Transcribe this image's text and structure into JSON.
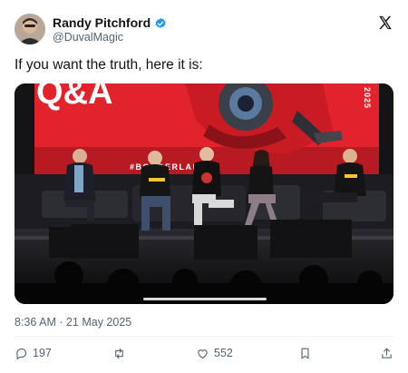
{
  "author": {
    "name": "Randy Pitchford",
    "handle": "@DuvalMagic",
    "verified": true
  },
  "brand_icon": "x-logo-icon",
  "tweet": {
    "text": "If you want the truth, here it is:",
    "timestamp": "8:36 AM · 21 May 2025"
  },
  "media": {
    "type": "video",
    "banner_text": "Q&A",
    "hashtag": "#BORDERLANDS4",
    "year": "2025",
    "accent_color": "#e8232a"
  },
  "actions": {
    "reply": {
      "icon": "reply-icon",
      "count": "197"
    },
    "repost": {
      "icon": "repost-icon"
    },
    "like": {
      "icon": "heart-icon",
      "count": "552"
    },
    "bookmark": {
      "icon": "bookmark-icon"
    },
    "share": {
      "icon": "share-icon"
    }
  }
}
